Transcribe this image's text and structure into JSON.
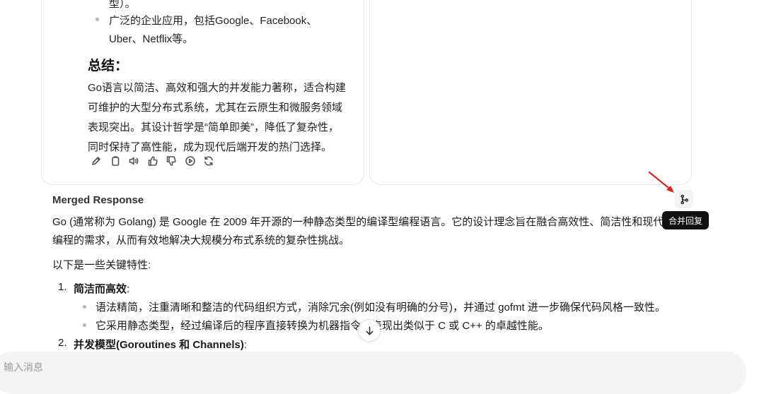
{
  "left_card": {
    "bullet_0_tail": "型）。",
    "bullet_1_line1": "广泛的企业应用，包括Google、Facebook、",
    "bullet_1_line2": "Uber、Netflix等。",
    "summary_heading": "总结：",
    "summary_lines": [
      "Go语言以简洁、高效和强大的并发能力著称，适合构建",
      "可维护的大型分布式系统，尤其在云原生和微服务领域",
      "表现突出。其设计哲学是“简单即美”，降低了复杂性，",
      "同时保持了高性能，成为现代后端开发的热门选择。"
    ],
    "toolbar_icons": [
      "edit-icon",
      "copy-icon",
      "speaker-icon",
      "thumbs-up-icon",
      "thumbs-down-icon",
      "play-icon",
      "regenerate-icon"
    ]
  },
  "merged": {
    "title": "Merged Response",
    "intro_line1": "Go (通常称为 Golang) 是 Google 在 2009 年开源的一种静态类型的编译型编程语言。它的设计理念旨在融合高效性、简洁性和现代",
    "intro_line2": "编程的需求，从而有效地解决大规模分布式系统的复杂性挑战。",
    "lead": "以下是一些关键特性:",
    "item1_num": "1.",
    "item1_title": "简洁而高效",
    "item1_colon": ":",
    "item1_bullets": [
      "语法精简，注重清晰和整洁的代码组织方式，消除冗余(例如没有明确的分号)，并通过 gofmt 进一步确保代码风格一致性。",
      "它采用静态类型，经过编译后的程序直接转换为机器指令，表现出类似于 C 或 C++ 的卓越性能。"
    ],
    "item2_num": "2.",
    "item2_title": "并发模型(Goroutines 和 Channels)",
    "item2_colon": ":"
  },
  "merge_button": {
    "icon": "merge-icon",
    "tooltip": "合并回复"
  },
  "scroll_button": {
    "icon": "arrow-down-icon"
  },
  "input": {
    "placeholder": "输入消息"
  },
  "colors": {
    "annotation_arrow": "#e02020",
    "tooltip_bg": "#111111",
    "input_bg": "#f4f4f4"
  }
}
